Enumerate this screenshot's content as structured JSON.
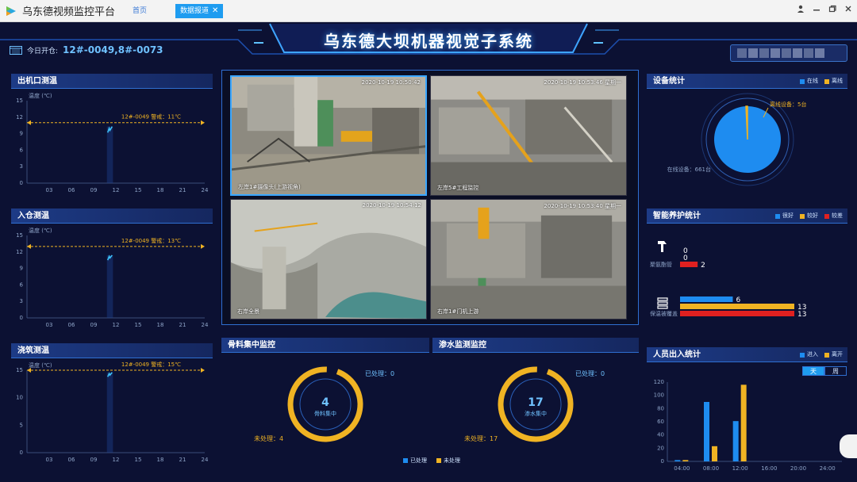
{
  "window": {
    "app_title": "乌东德视频监控平台",
    "tab_home": "首页",
    "tab_active": "数据报道",
    "tab_close": "✕"
  },
  "header": {
    "system_title": "乌东德大坝机器视觉子系统",
    "today_label": "今日开仓:",
    "today_value": "12#-0049,8#-0073"
  },
  "colors": {
    "accent": "#1e9cf0",
    "warning": "#f0b323",
    "danger": "#e02020",
    "panel_bg": "#0c1133"
  },
  "panels": {
    "outlet_temp": {
      "title": "出机口测温",
      "unit": "温度 (℃)",
      "warn_label": "12#-0049 警戒：11℃"
    },
    "inlet_temp": {
      "title": "入仓测温",
      "unit": "温度 (℃)",
      "warn_label": "12#-0049 警戒：13℃"
    },
    "pour_temp": {
      "title": "浇筑测温",
      "unit": "温度 (℃)",
      "warn_label": "12#-0049 警戒：15℃"
    },
    "aggregate": {
      "title": "骨料集中监控",
      "center_label": "骨料集中",
      "processed": "已处理：0",
      "unprocessed": "未处理：4"
    },
    "seepage": {
      "title": "渗水监测监控",
      "center_label": "渗水集中",
      "processed": "已处理：0",
      "unprocessed": "未处理：17"
    },
    "device_stats": {
      "title": "设备统计",
      "legend_online": "在线",
      "legend_offline": "离线",
      "offline_label": "离线设备：5台",
      "online_label": "在线设备：661台"
    },
    "maintenance": {
      "title": "智能养护统计",
      "legend_good": "很好",
      "legend_ok": "较好",
      "legend_bad": "较差",
      "row1_label": "聚氨酯管",
      "row2_label": "保温被覆盖"
    },
    "personnel": {
      "title": "人员出入统计",
      "legend_in": "进入",
      "legend_out": "离开",
      "toggle_day": "天",
      "toggle_week": "周"
    }
  },
  "bottom_legend": {
    "processed": "已处理",
    "unprocessed": "未处理"
  },
  "cameras": [
    {
      "ts": "2020-10-19 10:50:42",
      "name": "左岸1#摄像头(上游视角)"
    },
    {
      "ts": "2020-10-19 10:53:46 星期一",
      "name": "左岸5#工程监控"
    },
    {
      "ts": "2020-10-19 10:54:12",
      "name": "右岸全景"
    },
    {
      "ts": "2020-10-19 10:53:40 星期一",
      "name": "右岸1#门机上游"
    }
  ],
  "chart_data": [
    {
      "type": "line",
      "title": "出机口测温",
      "ylabel": "温度 (℃)",
      "x_ticks": [
        "03",
        "06",
        "09",
        "12",
        "15",
        "18",
        "21",
        "24"
      ],
      "y_ticks": [
        "0",
        "3",
        "6",
        "9",
        "12",
        "15"
      ],
      "ylim": [
        0,
        15
      ],
      "xlim": [
        0,
        24
      ],
      "warning_line": 11,
      "series": [
        {
          "x": [
            10.9,
            11.1,
            11.2,
            11.5
          ],
          "y": [
            9.2,
            10.0,
            9.6,
            10.3
          ]
        }
      ]
    },
    {
      "type": "line",
      "title": "入仓测温",
      "ylabel": "温度 (℃)",
      "x_ticks": [
        "03",
        "06",
        "09",
        "12",
        "15",
        "18",
        "21",
        "24"
      ],
      "y_ticks": [
        "0",
        "3",
        "6",
        "9",
        "12",
        "15"
      ],
      "ylim": [
        0,
        15
      ],
      "xlim": [
        0,
        24
      ],
      "warning_line": 13,
      "series": [
        {
          "x": [
            10.9,
            11.1,
            11.2,
            11.5
          ],
          "y": [
            10.5,
            11.2,
            10.9,
            11.4
          ]
        }
      ]
    },
    {
      "type": "line",
      "title": "浇筑测温",
      "ylabel": "温度 (℃)",
      "x_ticks": [
        "03",
        "06",
        "09",
        "12",
        "15",
        "18",
        "21",
        "24"
      ],
      "y_ticks": [
        "0",
        "5",
        "10",
        "15"
      ],
      "ylim": [
        0,
        15
      ],
      "xlim": [
        0,
        24
      ],
      "warning_line": 15,
      "series": [
        {
          "x": [
            10.9,
            11.1,
            11.2,
            11.5
          ],
          "y": [
            13.8,
            14.4,
            14.1,
            14.6
          ]
        }
      ]
    },
    {
      "type": "pie",
      "title": "设备统计",
      "labels": [
        "在线",
        "离线"
      ],
      "values": [
        661,
        5
      ]
    },
    {
      "type": "bar",
      "title": "智能养护统计",
      "categories": [
        "聚氨酯管",
        "保温被覆盖"
      ],
      "series": [
        {
          "name": "很好",
          "values": [
            0,
            6
          ]
        },
        {
          "name": "较好",
          "values": [
            0,
            13
          ]
        },
        {
          "name": "较差",
          "values": [
            2,
            13
          ]
        }
      ]
    },
    {
      "type": "bar",
      "title": "人员出入统计",
      "categories": [
        "04:00",
        "08:00",
        "12:00",
        "16:00",
        "20:00",
        "24:00"
      ],
      "y_ticks": [
        "0",
        "20",
        "40",
        "60",
        "80",
        "100",
        "120"
      ],
      "ylim": [
        0,
        120
      ],
      "series": [
        {
          "name": "进入",
          "values": [
            2,
            90,
            61,
            0,
            0,
            0
          ]
        },
        {
          "name": "离开",
          "values": [
            2,
            23,
            116,
            0,
            0,
            0
          ]
        }
      ]
    },
    {
      "type": "pie",
      "title": "骨料集中监控",
      "labels": [
        "已处理",
        "未处理"
      ],
      "values": [
        0,
        4
      ],
      "center_value": "4"
    },
    {
      "type": "pie",
      "title": "渗水监测监控",
      "labels": [
        "已处理",
        "未处理"
      ],
      "values": [
        0,
        17
      ],
      "center_value": "17"
    }
  ]
}
